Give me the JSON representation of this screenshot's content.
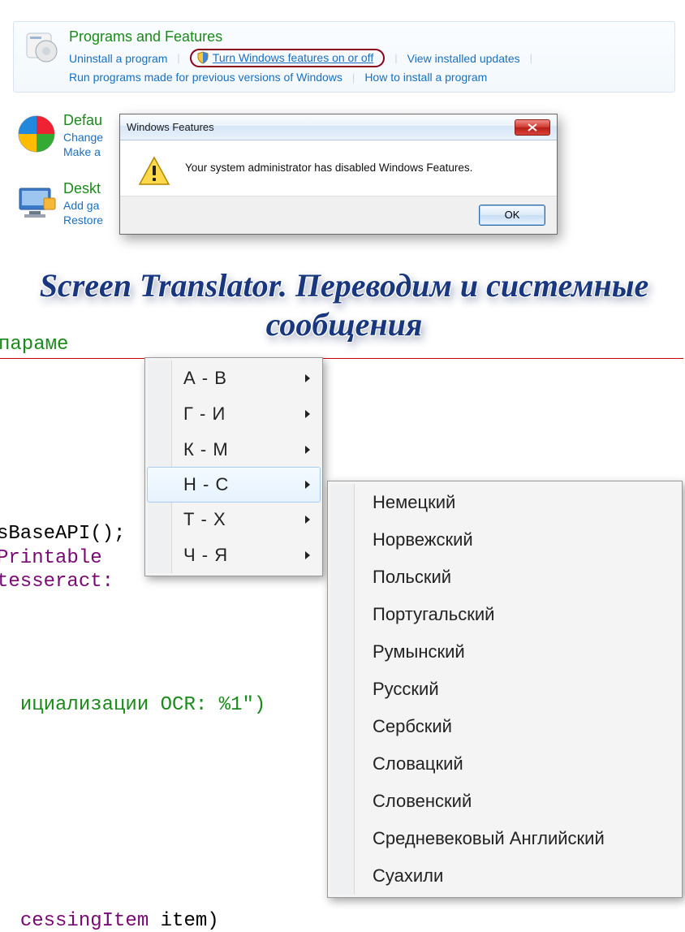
{
  "control_panel": {
    "title": "Programs and Features",
    "links": {
      "uninstall": "Uninstall a program",
      "turn_features": "Turn Windows features on or off",
      "view_updates": "View installed updates",
      "run_previous": "Run programs made for previous versions of Windows",
      "how_install": "How to install a program"
    }
  },
  "categories": {
    "default": {
      "title_partial": "Defau",
      "sub1_partial": "Change",
      "sub2_partial": "Make a"
    },
    "desktop": {
      "title_partial": "Deskt",
      "sub1_partial": "Add ga",
      "sub2_partial": "Restore"
    }
  },
  "dialog": {
    "title": "Windows Features",
    "message": "Your system administrator has disabled Windows Features.",
    "ok": "OK"
  },
  "headline": "Screen Translator. Переводим и системные сообщения",
  "background_code": {
    "param": "параме",
    "line1": "sBaseAPI();",
    "line2": "Printable",
    "line3": "tesseract:",
    "line4_a": "ициализации",
    "line4_b": " OCR: %1\")",
    "line5_a": "cessingItem",
    "line5_b": " item)"
  },
  "menu1": {
    "items": [
      "А - В",
      "Г - И",
      "К - М",
      "Н - С",
      "Т - Х",
      "Ч - Я"
    ],
    "hover_index": 3
  },
  "menu2": {
    "items": [
      "Немецкий",
      "Норвежский",
      "Польский",
      "Португальский",
      "Румынский",
      "Русский",
      "Сербский",
      "Словацкий",
      "Словенский",
      "Средневековый Английский",
      "Суахили"
    ]
  }
}
